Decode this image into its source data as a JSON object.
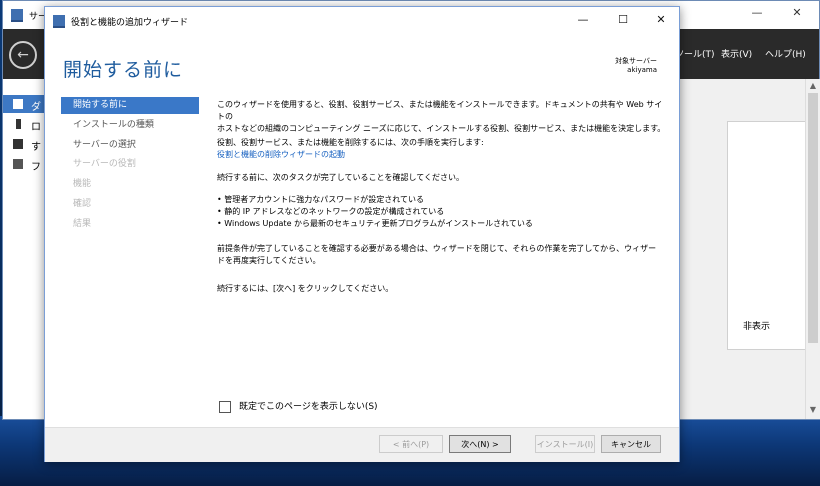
{
  "background_window": {
    "title": "サー",
    "menu": {
      "tools": "ツール(T)",
      "view": "表示(V)",
      "help": "ヘルプ(H)"
    },
    "nav_items": [
      {
        "label": "ダ",
        "icon": "dashboard-icon",
        "selected": true
      },
      {
        "label": "ロ",
        "icon": "local-server-icon",
        "selected": false
      },
      {
        "label": "す",
        "icon": "all-servers-icon",
        "selected": false
      },
      {
        "label": "フ",
        "icon": "file-services-icon",
        "selected": false
      }
    ],
    "hide_label": "非表示",
    "controls": {
      "minimize": "—",
      "maximize": "☐",
      "close": "✕"
    }
  },
  "wizard": {
    "title": "役割と機能の追加ウィザード",
    "controls": {
      "minimize": "—",
      "maximize": "☐",
      "close": "✕"
    },
    "heading": "開始する前に",
    "target_server_label": "対象サーバー",
    "target_server_value": "akiyama",
    "steps": [
      {
        "label": "開始する前に",
        "state": "active"
      },
      {
        "label": "インストールの種類",
        "state": "normal"
      },
      {
        "label": "サーバーの選択",
        "state": "normal"
      },
      {
        "label": "サーバーの役割",
        "state": "disabled"
      },
      {
        "label": "機能",
        "state": "disabled"
      },
      {
        "label": "確認",
        "state": "disabled"
      },
      {
        "label": "結果",
        "state": "disabled"
      }
    ],
    "content": {
      "para1_line1": "このウィザードを使用すると、役割、役割サービス、または機能をインストールできます。ドキュメントの共有や Web サイトの",
      "para1_line2": "ホストなどの組織のコンピューティング ニーズに応じて、インストールする役割、役割サービス、または機能を決定します。",
      "para2": "役割、役割サービス、または機能を削除するには、次の手順を実行します:",
      "remove_link": "役割と機能の削除ウィザードの起動",
      "para3": "続行する前に、次のタスクが完了していることを確認してください。",
      "bullets": [
        "• 管理者アカウントに強力なパスワードが設定されている",
        "• 静的 IP アドレスなどのネットワークの設定が構成されている",
        "• Windows Update から最新のセキュリティ更新プログラムがインストールされている"
      ],
      "para4_line1": "前提条件が完了していることを確認する必要がある場合は、ウィザードを閉じて、それらの作業を完了してから、ウィザー",
      "para4_line2": "ドを再度実行してください。",
      "para5": "続行するには、[次へ] をクリックしてください。"
    },
    "skip_checkbox_label": "既定でこのページを表示しない(S)",
    "skip_checkbox_checked": false,
    "buttons": {
      "previous": "< 前へ(P)",
      "next": "次へ(N) >",
      "install": "インストール(I)",
      "cancel": "キャンセル"
    }
  }
}
